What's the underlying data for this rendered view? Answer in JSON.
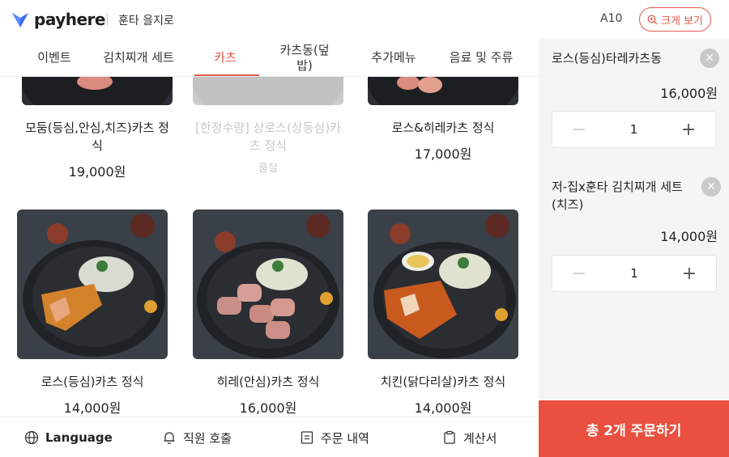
{
  "header": {
    "brand": "payhere",
    "store_name": "훈타 을지로",
    "table_no": "A10",
    "zoom_label": "크게 보기"
  },
  "tabs": [
    {
      "label": "이벤트"
    },
    {
      "label": "김치찌개 세트"
    },
    {
      "label": "카츠",
      "active": true
    },
    {
      "label": "카츠동(덮밥)"
    },
    {
      "label": "추가메뉴"
    },
    {
      "label": "음료 및 주류"
    }
  ],
  "menu": [
    {
      "name": "모둠(등심,안심,치즈)카츠 정식",
      "price": "19,000원"
    },
    {
      "name": "[한정수량] 상로스(상등심)카츠 정식",
      "soldout_label": "품절",
      "soldout": true
    },
    {
      "name": "로스&히레카츠 정식",
      "price": "17,000원"
    },
    {
      "name": "로스(등심)카츠 정식",
      "price": "14,000원"
    },
    {
      "name": "히레(안심)카츠 정식",
      "price": "16,000원"
    },
    {
      "name": "치킨(닭다리살)카츠 정식",
      "price": "14,000원"
    }
  ],
  "cart": {
    "items": [
      {
        "name": "로스(등심)타레카츠동",
        "price": "16,000원",
        "qty": "1",
        "minus": "−",
        "plus": "+",
        "remove": "✕"
      },
      {
        "name": "저-집x훈타 김치찌개 세트(치즈)",
        "price": "14,000원",
        "qty": "1",
        "minus": "−",
        "plus": "+",
        "remove": "✕"
      }
    ],
    "order_button": "총 2개 주문하기"
  },
  "bottom_bar": {
    "language": "Language",
    "call_staff": "직원 호출",
    "order_history": "주문 내역",
    "bill": "계산서"
  },
  "icons": {
    "logo": "payhere-logo-icon",
    "zoom": "zoom-icon",
    "language": "globe-icon",
    "call": "bell-icon",
    "history": "receipt-list-icon",
    "bill": "clipboard-icon",
    "remove": "close-icon"
  },
  "colors": {
    "accent": "#e25a4c",
    "order_button": "#e9503f",
    "cart_bg": "#f5f5f5"
  }
}
